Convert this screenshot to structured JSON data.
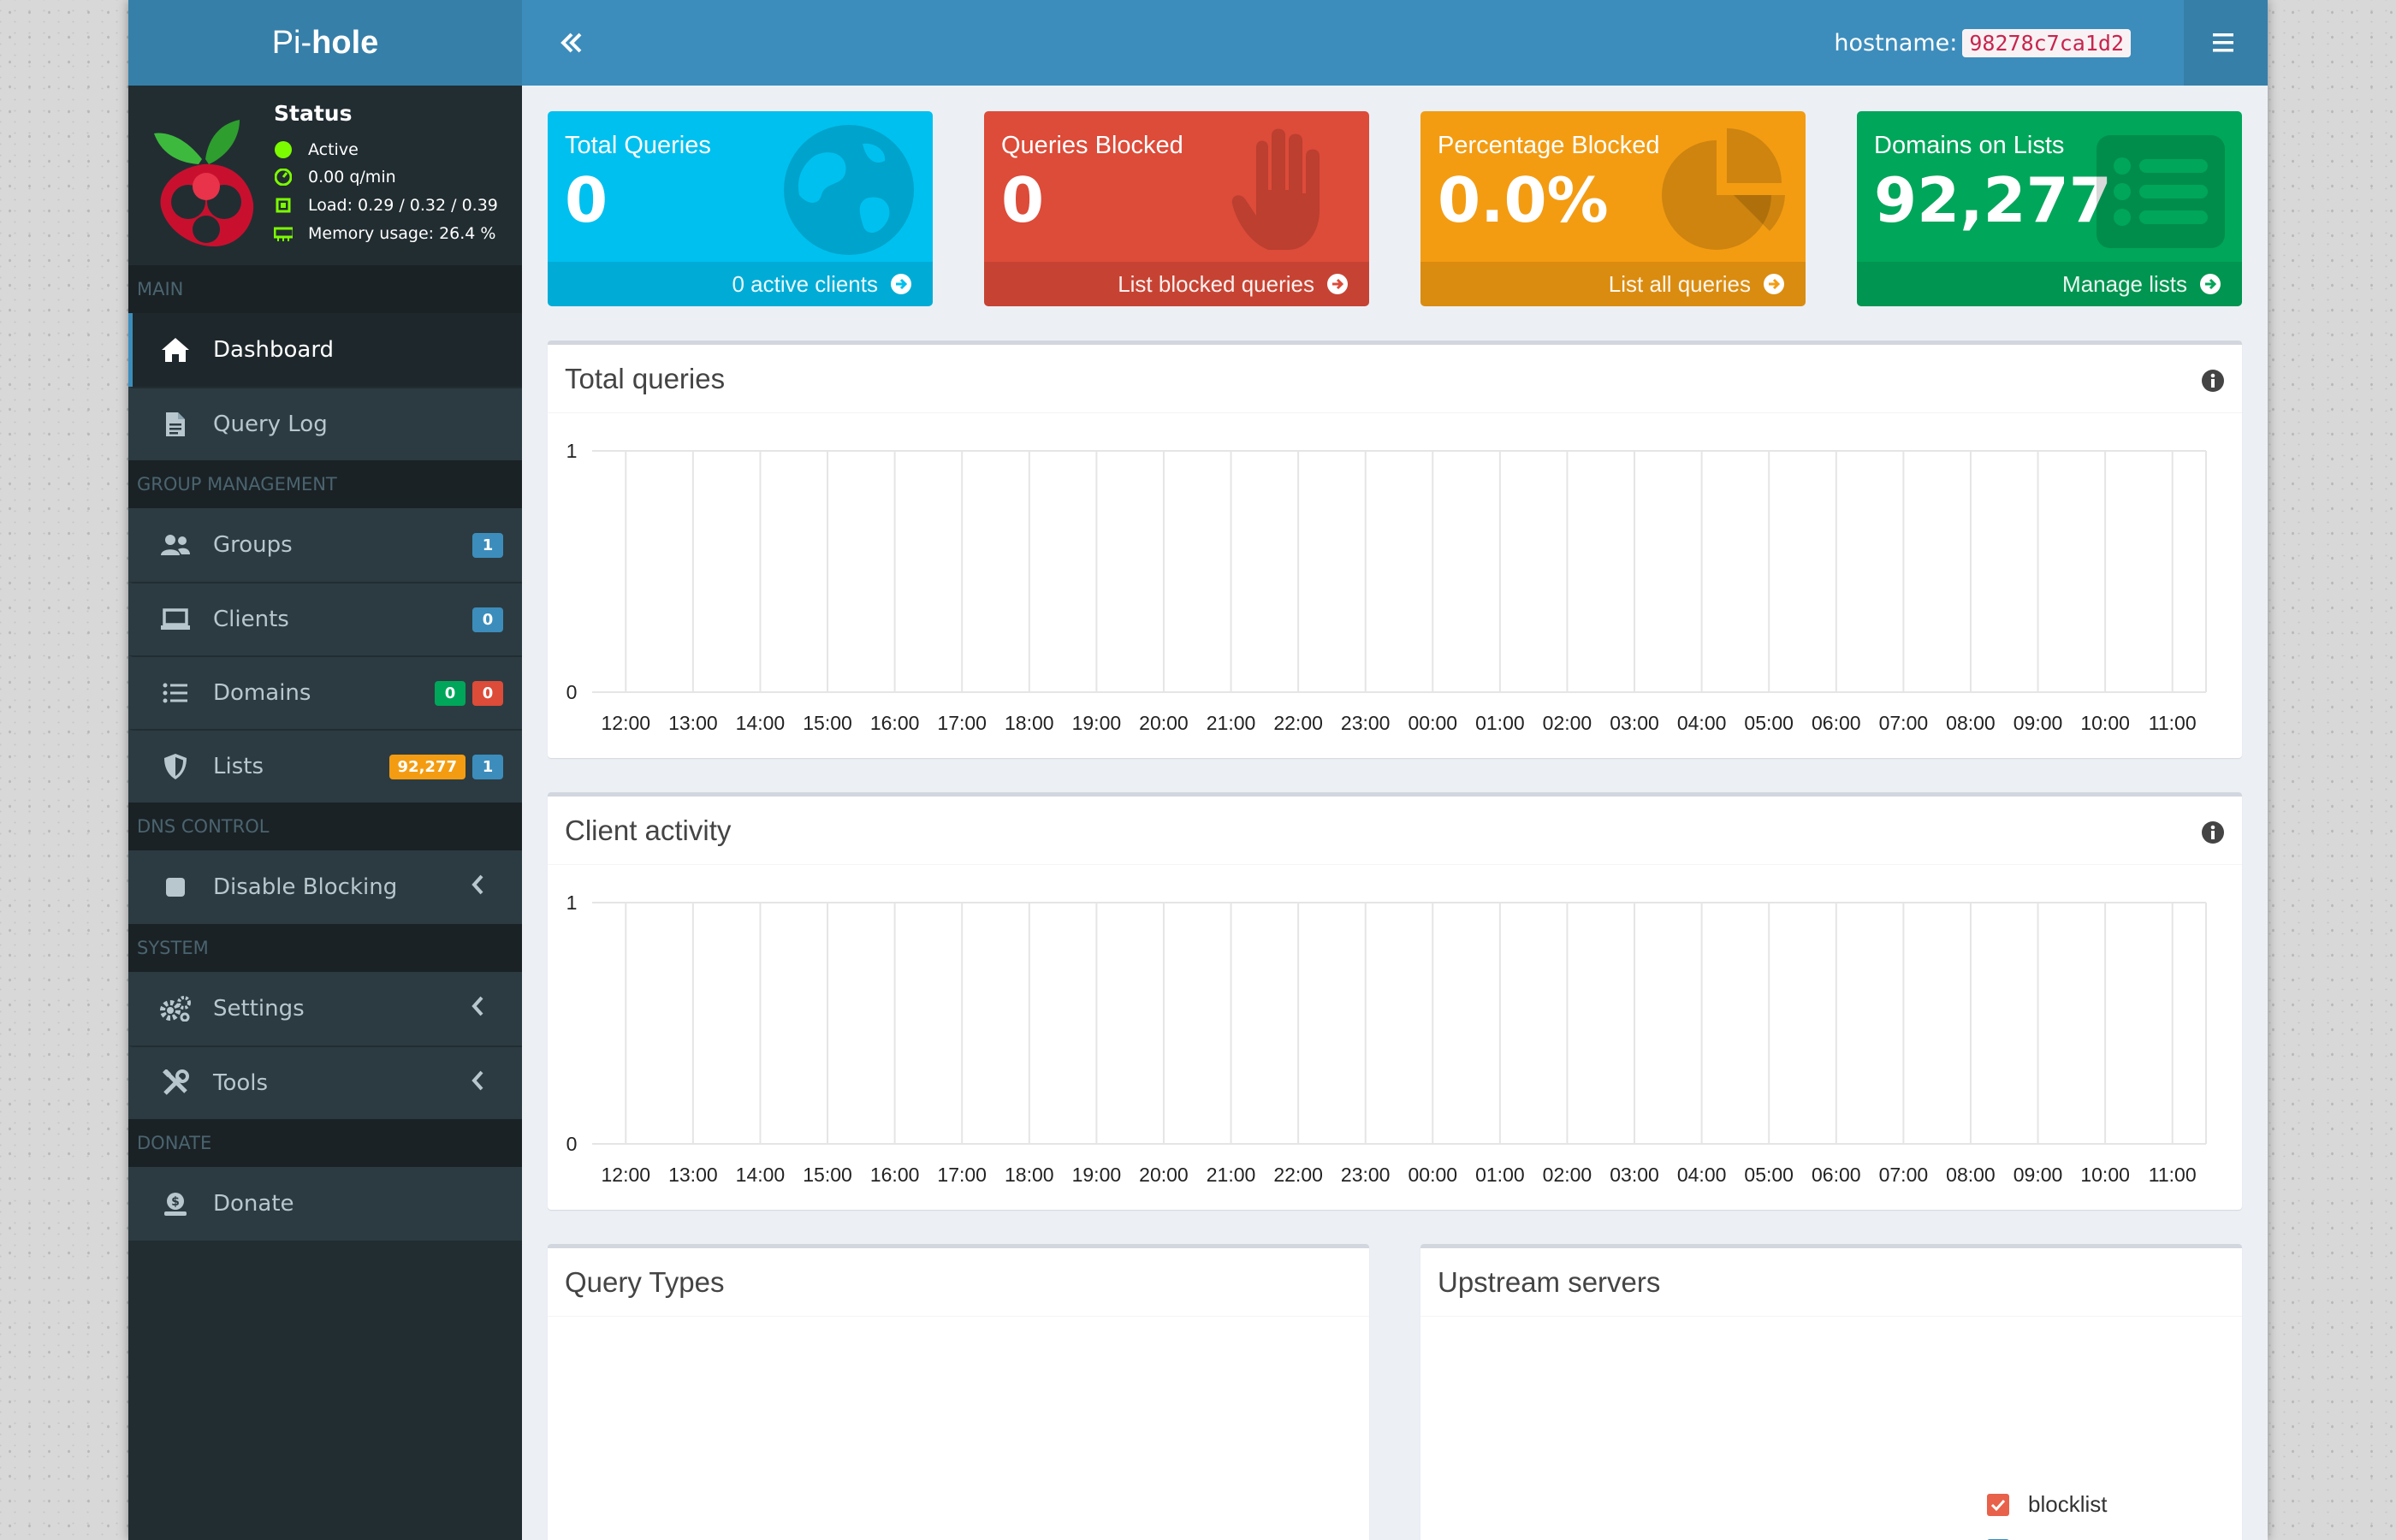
{
  "brand": {
    "prefix": "Pi-",
    "name": "hole"
  },
  "status": {
    "title": "Status",
    "active": "Active",
    "rate": "0.00 q/min",
    "load": "Load: 0.29 / 0.32 / 0.39",
    "memory": "Memory usage: 26.4 %"
  },
  "sidebar": {
    "sections": {
      "main": "MAIN",
      "group": "GROUP MANAGEMENT",
      "dns": "DNS CONTROL",
      "system": "SYSTEM",
      "donate": "DONATE"
    },
    "items": {
      "dashboard": "Dashboard",
      "query_log": "Query Log",
      "groups": "Groups",
      "groups_badge": "1",
      "clients": "Clients",
      "clients_badge": "0",
      "domains": "Domains",
      "domains_badge_allow": "0",
      "domains_badge_deny": "0",
      "lists": "Lists",
      "lists_badge_domains": "92,277",
      "lists_badge_count": "1",
      "disable_blocking": "Disable Blocking",
      "settings": "Settings",
      "tools": "Tools",
      "donate": "Donate"
    }
  },
  "header": {
    "hostname_label": "hostname:",
    "hostname": "98278c7ca1d2"
  },
  "stats": [
    {
      "title": "Total Queries",
      "value": "0",
      "footer": "0 active clients",
      "color": "#00c0ef"
    },
    {
      "title": "Queries Blocked",
      "value": "0",
      "footer": "List blocked queries",
      "color": "#dd4b39"
    },
    {
      "title": "Percentage Blocked",
      "value": "0.0%",
      "footer": "List all queries",
      "color": "#f39c12"
    },
    {
      "title": "Domains on Lists",
      "value": "92,277",
      "footer": "Manage lists",
      "color": "#00a65a"
    }
  ],
  "panels": {
    "total_queries": "Total queries",
    "client_activity": "Client activity",
    "query_types": "Query Types",
    "upstream": "Upstream servers"
  },
  "chart_data": [
    {
      "type": "bar",
      "title": "Total queries",
      "categories": [
        "12:00",
        "13:00",
        "14:00",
        "15:00",
        "16:00",
        "17:00",
        "18:00",
        "19:00",
        "20:00",
        "21:00",
        "22:00",
        "23:00",
        "00:00",
        "01:00",
        "02:00",
        "03:00",
        "04:00",
        "05:00",
        "06:00",
        "07:00",
        "08:00",
        "09:00",
        "10:00",
        "11:00"
      ],
      "values": [
        0,
        0,
        0,
        0,
        0,
        0,
        0,
        0,
        0,
        0,
        0,
        0,
        0,
        0,
        0,
        0,
        0,
        0,
        0,
        0,
        0,
        0,
        0,
        0
      ],
      "ylim": [
        0,
        1
      ],
      "yticks": [
        "0",
        "1"
      ],
      "grid": true
    },
    {
      "type": "bar",
      "title": "Client activity",
      "categories": [
        "12:00",
        "13:00",
        "14:00",
        "15:00",
        "16:00",
        "17:00",
        "18:00",
        "19:00",
        "20:00",
        "21:00",
        "22:00",
        "23:00",
        "00:00",
        "01:00",
        "02:00",
        "03:00",
        "04:00",
        "05:00",
        "06:00",
        "07:00",
        "08:00",
        "09:00",
        "10:00",
        "11:00"
      ],
      "values": [
        0,
        0,
        0,
        0,
        0,
        0,
        0,
        0,
        0,
        0,
        0,
        0,
        0,
        0,
        0,
        0,
        0,
        0,
        0,
        0,
        0,
        0,
        0,
        0
      ],
      "ylim": [
        0,
        1
      ],
      "yticks": [
        "0",
        "1"
      ],
      "grid": true
    }
  ],
  "upstream_legend": [
    {
      "name": "blocklist",
      "color": "#e8614a"
    }
  ],
  "colors": {
    "header": "#3c8dbc",
    "sidebar": "#222d32",
    "accent": "#3c8dbc",
    "orange": "#f39c12",
    "green": "#00a65a",
    "red": "#dd4b39"
  }
}
